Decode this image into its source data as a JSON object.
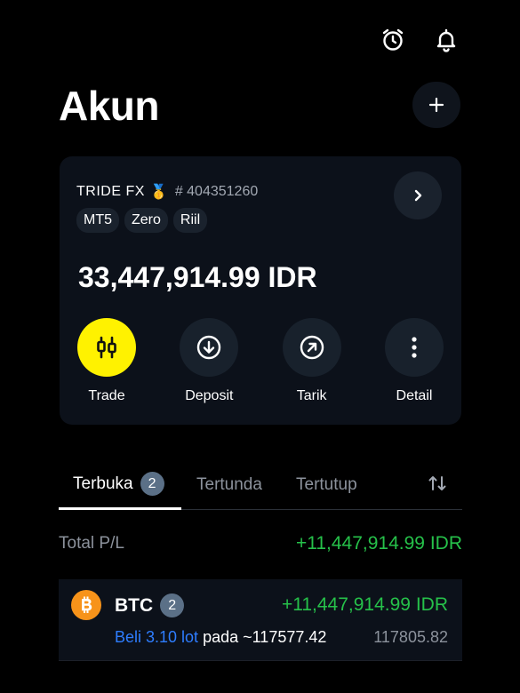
{
  "header": {
    "title": "Akun",
    "icons": [
      "alarm-icon",
      "bell-icon",
      "plus-icon"
    ]
  },
  "account": {
    "broker": "TRIDE FX",
    "medal": "🥇",
    "number": "# 404351260",
    "tags": [
      "MT5",
      "Zero",
      "Riil"
    ],
    "balance": "33,447,914.99 IDR",
    "actions": [
      {
        "label": "Trade",
        "icon": "candlestick-icon"
      },
      {
        "label": "Deposit",
        "icon": "arrow-down-circle-icon"
      },
      {
        "label": "Tarik",
        "icon": "arrow-up-right-circle-icon"
      },
      {
        "label": "Detail",
        "icon": "more-vertical-icon"
      }
    ]
  },
  "tabs": {
    "open_label": "Terbuka",
    "open_count": "2",
    "pending_label": "Tertunda",
    "closed_label": "Tertutup"
  },
  "summary": {
    "total_label": "Total P/L",
    "total_value": "+11,447,914.99 IDR"
  },
  "positions": [
    {
      "symbol": "BTC",
      "count": "2",
      "pl": "+11,447,914.99 IDR",
      "side_lot": "Beli 3.10 lot",
      "open_text": "pada ~117577.42",
      "current_price": "117805.82"
    }
  ],
  "colors": {
    "accent": "#fff200",
    "profit": "#26c14a",
    "buy": "#2e7dff",
    "badge": "#5b7087"
  }
}
